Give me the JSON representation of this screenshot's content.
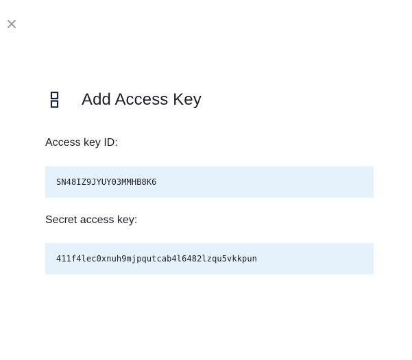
{
  "dialog": {
    "close_icon": "close-icon",
    "title_icon": "key-icon",
    "title": "Add Access Key"
  },
  "fields": {
    "access_key_id": {
      "label": "Access key ID:",
      "value": "SN48IZ9JYUY03MMHB8K6"
    },
    "secret_access_key": {
      "label": "Secret access key:",
      "value": "411f4lec0xnuh9mjpqutcab4l6482lzqu5vkkpun"
    }
  },
  "colors": {
    "field_background": "#e6f2fb",
    "close_icon": "#9a9a9a",
    "icon": "#1c1c3b",
    "text": "#1c1c2b"
  }
}
